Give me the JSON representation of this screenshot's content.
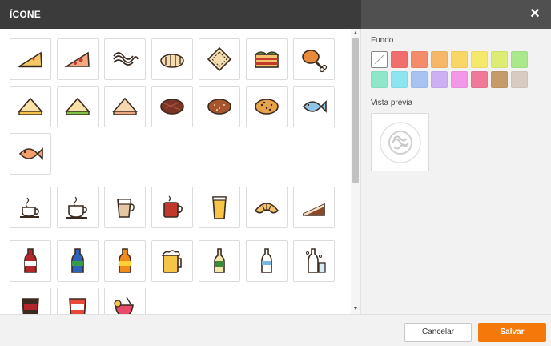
{
  "header": {
    "title": "ÍCONE",
    "close_label": "✕"
  },
  "sidebar": {
    "background_label": "Fundo",
    "preview_label": "Vista prévia",
    "colors": [
      "none",
      "#f26d6d",
      "#f48c6b",
      "#f6b867",
      "#f8d766",
      "#f5e86a",
      "#dded73",
      "#a9e88b",
      "#8ee7c8",
      "#8de5ef",
      "#a7c2f3",
      "#cdb0f3",
      "#f397e7",
      "#f0799a",
      "#c69a69",
      "#d8ccc2"
    ]
  },
  "icons": {
    "group1": [
      [
        "pizza-slice",
        "pizza-slice-pepperoni",
        "pasta",
        "bread-roll",
        "ravioli",
        "lasagna",
        "chicken-leg"
      ],
      [
        "cheese-sandwich",
        "sandwich-green",
        "sandwich",
        "steak",
        "bread-loaf",
        "focaccia",
        "fish-blue"
      ],
      [
        "fish-orange"
      ]
    ],
    "group2": [
      [
        "espresso-cup",
        "coffee-mug",
        "latte-glass",
        "tea-mug",
        "beer-glass",
        "croissant",
        "cake-slice"
      ]
    ],
    "group3": [
      [
        "cola-bottle",
        "soda-bottle-green",
        "orange-soda-bottle",
        "beer-mug",
        "beer-bottle",
        "water-bottle",
        "water-bottle-glass"
      ],
      [
        "cola-cup",
        "red-soda-cup",
        "cocktail"
      ]
    ]
  },
  "footer": {
    "cancel": "Cancelar",
    "save": "Salvar"
  }
}
